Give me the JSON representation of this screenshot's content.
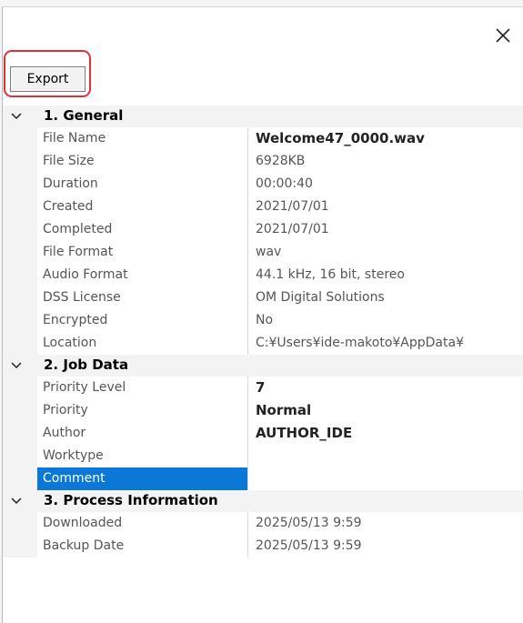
{
  "window": {
    "close_glyph": "✕"
  },
  "toolbar": {
    "export_label": "Export"
  },
  "sections": [
    {
      "label": "1. General",
      "rows": [
        {
          "name": "File Name",
          "value": "Welcome47_0000.wav",
          "bold": true
        },
        {
          "name": "File Size",
          "value": "6928KB"
        },
        {
          "name": "Duration",
          "value": "00:00:40"
        },
        {
          "name": "Created",
          "value": "2021/07/01"
        },
        {
          "name": "Completed",
          "value": "2021/07/01"
        },
        {
          "name": "File Format",
          "value": "wav"
        },
        {
          "name": "Audio Format",
          "value": "44.1 kHz, 16 bit, stereo"
        },
        {
          "name": "DSS License",
          "value": "OM Digital Solutions"
        },
        {
          "name": "Encrypted",
          "value": "No"
        },
        {
          "name": "Location",
          "value": "C:¥Users¥ide-makoto¥AppData¥"
        }
      ]
    },
    {
      "label": "2. Job Data",
      "rows": [
        {
          "name": "Priority Level",
          "value": "7",
          "bold": true
        },
        {
          "name": "Priority",
          "value": "Normal",
          "bold": true
        },
        {
          "name": "Author",
          "value": "AUTHOR_IDE",
          "bold": true
        },
        {
          "name": "Worktype",
          "value": ""
        },
        {
          "name": "Comment",
          "value": "",
          "selected": true
        }
      ]
    },
    {
      "label": "3. Process Information",
      "rows": [
        {
          "name": "Downloaded",
          "value": "2025/05/13 9:59"
        },
        {
          "name": "Backup Date",
          "value": "2025/05/13 9:59"
        }
      ]
    }
  ],
  "colors": {
    "selection": "#0b78d7",
    "highlight_frame": "#e0303a",
    "category_background": "#f3f3f3"
  }
}
